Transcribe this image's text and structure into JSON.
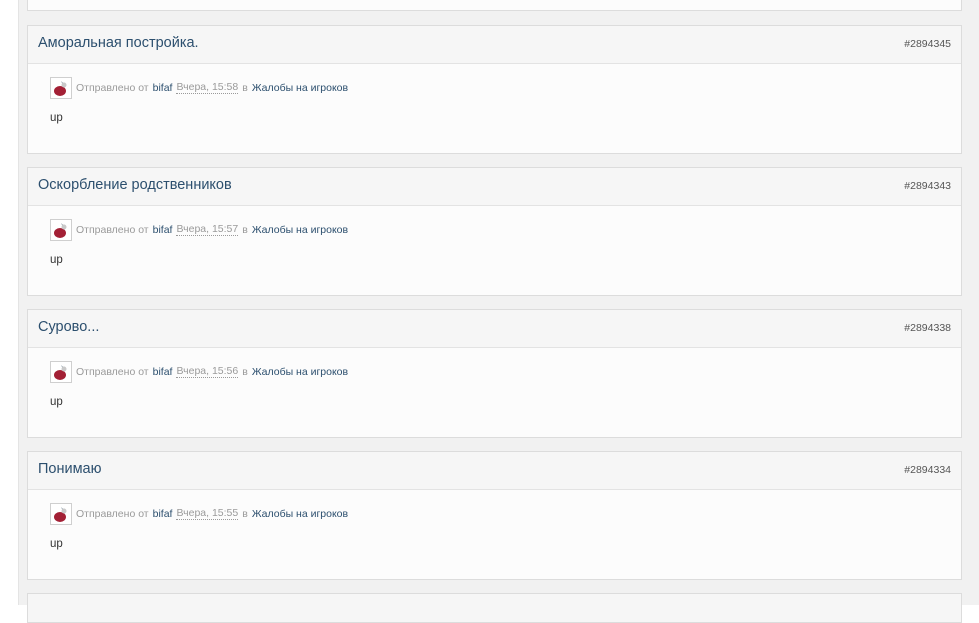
{
  "results": [
    {
      "title": "Аморальная постройка.",
      "id": "#2894345",
      "sent_label": "Отправлено от",
      "author": "bifaf",
      "time": "Вчера, 15:58",
      "in_label": "в",
      "forum": "Жалобы на игроков",
      "snippet": "up"
    },
    {
      "title": "Оскорбление родственников",
      "id": "#2894343",
      "sent_label": "Отправлено от",
      "author": "bifaf",
      "time": "Вчера, 15:57",
      "in_label": "в",
      "forum": "Жалобы на игроков",
      "snippet": "up"
    },
    {
      "title": "Сурово...",
      "id": "#2894338",
      "sent_label": "Отправлено от",
      "author": "bifaf",
      "time": "Вчера, 15:56",
      "in_label": "в",
      "forum": "Жалобы на игроков",
      "snippet": "up"
    },
    {
      "title": "Понимаю",
      "id": "#2894334",
      "sent_label": "Отправлено от",
      "author": "bifaf",
      "time": "Вчера, 15:55",
      "in_label": "в",
      "forum": "Жалобы на игроков",
      "snippet": "up"
    }
  ],
  "colors": {
    "link": "#2c4f6e",
    "meta": "#9a9a9a",
    "card_bg": "#fcfcfc",
    "header_bg": "#f6f6f6"
  },
  "icons": {
    "avatar": "user-avatar-icon"
  }
}
